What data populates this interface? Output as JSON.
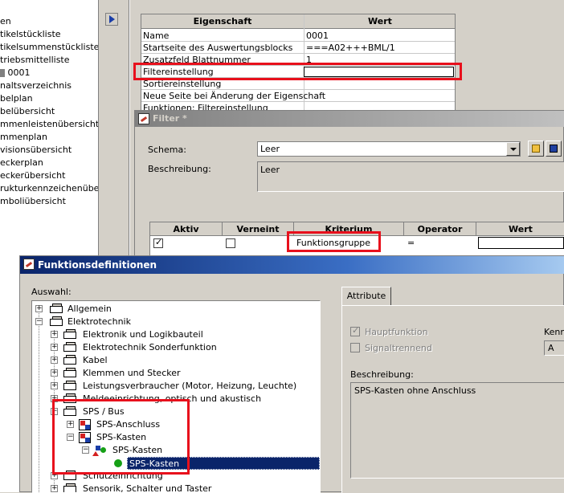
{
  "left_list": {
    "items": [
      "en",
      "tikelstückliste",
      "tikelsummenstückliste",
      "triebsmittelliste",
      "0001",
      "nalts­verzeichnis",
      "belplan",
      "belübersicht",
      "mmenleistenübersicht",
      "mmenplan",
      "visionsübersicht",
      "eckerplan",
      "eckerübersicht",
      "ruktur­kennzeichen­übersic",
      "mboliübersicht"
    ]
  },
  "property_table": {
    "headers": [
      "Eigenschaft",
      "Wert"
    ],
    "rows": [
      [
        "Name",
        "0001"
      ],
      [
        "Startseite des Auswertungsblocks",
        "===A02+++BML/1"
      ],
      [
        "Zusatzfeld Blattnummer",
        "1"
      ],
      [
        "Filtereinstellung",
        ""
      ],
      [
        "Sortiereinstellung",
        ""
      ],
      [
        "Neue Seite bei Änderung der Eigenschaft",
        ""
      ],
      [
        "Funktionen: Filtereinstellung",
        ""
      ]
    ]
  },
  "filter_window": {
    "title": "Filter *",
    "schema_label": "Schema:",
    "schema_value": "Leer",
    "description_label": "Beschreibung:",
    "description_value": "Leer",
    "criteria_headers": [
      "Aktiv",
      "Verneint",
      "Kriterium",
      "Operator",
      "Wert"
    ],
    "criteria_row": {
      "aktiv": true,
      "verneint": false,
      "kriterium": "Funktionsgruppe",
      "operator": "=",
      "wert": ""
    }
  },
  "function_window": {
    "title": "Funktionsdefinitionen",
    "selection_label": "Auswahl:",
    "tree": [
      {
        "label": "Allgemein",
        "level": 0,
        "expander": "+",
        "icon": "folder"
      },
      {
        "label": "Elektrotechnik",
        "level": 0,
        "expander": "-",
        "icon": "folder"
      },
      {
        "label": "Elektronik und Logikbauteil",
        "level": 1,
        "expander": "+",
        "icon": "folder"
      },
      {
        "label": "Elektrotechnik Sonderfunktion",
        "level": 1,
        "expander": "+",
        "icon": "folder"
      },
      {
        "label": "Kabel",
        "level": 1,
        "expander": "+",
        "icon": "folder"
      },
      {
        "label": "Klemmen und Stecker",
        "level": 1,
        "expander": "+",
        "icon": "folder"
      },
      {
        "label": "Leistungsverbraucher (Motor, Heizung, Leuchte)",
        "level": 1,
        "expander": "+",
        "icon": "folder"
      },
      {
        "label": "Meldeeinrichtung, optisch und akustisch",
        "level": 1,
        "expander": "+",
        "icon": "folder"
      },
      {
        "label": "SPS / Bus",
        "level": 1,
        "expander": "-",
        "icon": "folder"
      },
      {
        "label": "SPS-Anschluss",
        "level": 2,
        "expander": "+",
        "icon": "sps"
      },
      {
        "label": "SPS-Kasten",
        "level": 2,
        "expander": "-",
        "icon": "sps"
      },
      {
        "label": "SPS-Kasten",
        "level": 3,
        "expander": "-",
        "icon": "sps-symbol"
      },
      {
        "label": "SPS-Kasten",
        "level": 4,
        "expander": "",
        "icon": "green-dot",
        "selected": true
      },
      {
        "label": "Schutzeinrichtung",
        "level": 1,
        "expander": "+",
        "icon": "folder"
      },
      {
        "label": "Sensorik, Schalter und Taster",
        "level": 1,
        "expander": "+",
        "icon": "folder"
      }
    ],
    "attribute_tab": "Attribute",
    "hauptfunktion_label": "Hauptfunktion",
    "signaltrennend_label": "Signaltrennend",
    "kenn_label": "Kennl",
    "kenn_value": "A",
    "desc_label": "Beschreibung:",
    "desc_value": "SPS-Kasten ohne Anschluss"
  },
  "colors": {
    "highlight_red": "#e8101c",
    "selection_blue": "#0a246a"
  }
}
